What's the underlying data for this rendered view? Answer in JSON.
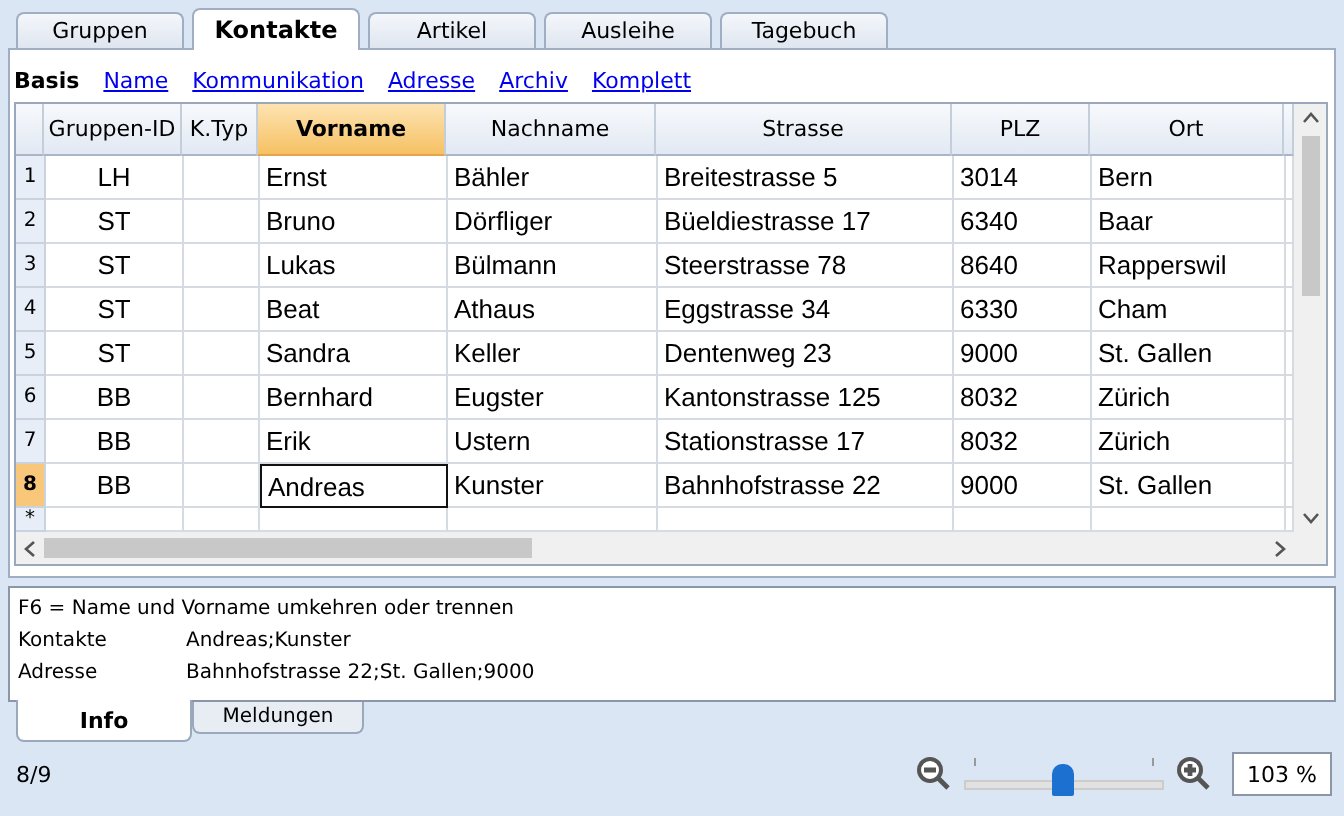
{
  "tabs": [
    {
      "label": "Gruppen",
      "selected": false
    },
    {
      "label": "Kontakte",
      "selected": true
    },
    {
      "label": "Artikel",
      "selected": false
    },
    {
      "label": "Ausleihe",
      "selected": false
    },
    {
      "label": "Tagebuch",
      "selected": false
    }
  ],
  "views": [
    {
      "label": "Basis",
      "selected": true
    },
    {
      "label": "Name",
      "selected": false
    },
    {
      "label": "Kommunikation",
      "selected": false
    },
    {
      "label": "Adresse",
      "selected": false
    },
    {
      "label": "Archiv",
      "selected": false
    },
    {
      "label": "Komplett",
      "selected": false
    }
  ],
  "table": {
    "columns": [
      {
        "label": "Gruppen-ID",
        "selected": false
      },
      {
        "label": "K.Typ",
        "selected": false
      },
      {
        "label": "Vorname",
        "selected": true
      },
      {
        "label": "Nachname",
        "selected": false
      },
      {
        "label": "Strasse",
        "selected": false
      },
      {
        "label": "PLZ",
        "selected": false
      },
      {
        "label": "Ort",
        "selected": false
      }
    ],
    "rows": [
      {
        "number": "1",
        "selected": false,
        "cells": [
          "LH",
          "",
          "Ernst",
          "Bähler",
          "Breitestrasse 5",
          "3014",
          "Bern"
        ]
      },
      {
        "number": "2",
        "selected": false,
        "cells": [
          "ST",
          "",
          "Bruno",
          "Dörfliger",
          "Büeldiestrasse 17",
          "6340",
          "Baar"
        ]
      },
      {
        "number": "3",
        "selected": false,
        "cells": [
          "ST",
          "",
          "Lukas",
          "Bülmann",
          "Steerstrasse 78",
          "8640",
          "Rapperswil"
        ]
      },
      {
        "number": "4",
        "selected": false,
        "cells": [
          "ST",
          "",
          "Beat",
          "Athaus",
          "Eggstrasse 34",
          "6330",
          "Cham"
        ]
      },
      {
        "number": "5",
        "selected": false,
        "cells": [
          "ST",
          "",
          "Sandra",
          "Keller",
          "Dentenweg 23",
          "9000",
          "St. Gallen"
        ]
      },
      {
        "number": "6",
        "selected": false,
        "cells": [
          "BB",
          "",
          "Bernhard",
          "Eugster",
          "Kantonstrasse 125",
          "8032",
          "Zürich"
        ]
      },
      {
        "number": "7",
        "selected": false,
        "cells": [
          "BB",
          "",
          "Erik",
          "Ustern",
          "Stationstrasse 17",
          "8032",
          "Zürich"
        ]
      },
      {
        "number": "8",
        "selected": true,
        "cells": [
          "BB",
          "",
          "Andreas",
          "Kunster",
          "Bahnhofstrasse 22",
          "9000",
          "St. Gallen"
        ]
      }
    ],
    "new_row_marker": "*"
  },
  "info": {
    "hint": "F6 = Name und Vorname umkehren oder trennen",
    "lines": [
      {
        "label": "Kontakte",
        "value": "Andreas;Kunster"
      },
      {
        "label": "Adresse",
        "value": "Bahnhofstrasse 22;St. Gallen;9000"
      }
    ]
  },
  "info_tabs": [
    {
      "label": "Info",
      "selected": true
    },
    {
      "label": "Meldungen",
      "selected": false
    }
  ],
  "status_bar": {
    "record": "8/9",
    "zoom": {
      "level": 0.5,
      "value": "103 %"
    }
  }
}
